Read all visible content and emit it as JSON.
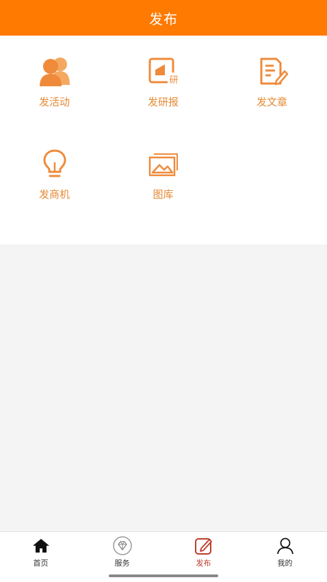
{
  "header": {
    "title": "发布"
  },
  "grid": {
    "items": [
      {
        "label": "发活动",
        "icon": "people-group-icon"
      },
      {
        "label": "发研报",
        "icon": "research-report-icon",
        "badge": "研"
      },
      {
        "label": "发文章",
        "icon": "article-edit-icon"
      },
      {
        "label": "发商机",
        "icon": "lightbulb-icon"
      },
      {
        "label": "图库",
        "icon": "image-gallery-icon"
      }
    ]
  },
  "tabbar": {
    "tabs": [
      {
        "label": "首页",
        "icon": "home-icon",
        "active": false
      },
      {
        "label": "服务",
        "icon": "diamond-icon",
        "active": false
      },
      {
        "label": "发布",
        "icon": "compose-icon",
        "active": true
      },
      {
        "label": "我的",
        "icon": "user-icon",
        "active": false
      }
    ]
  },
  "colors": {
    "accent": "#ff7a00",
    "icon": "#ef8a3a",
    "active_tab": "#c0392b"
  }
}
